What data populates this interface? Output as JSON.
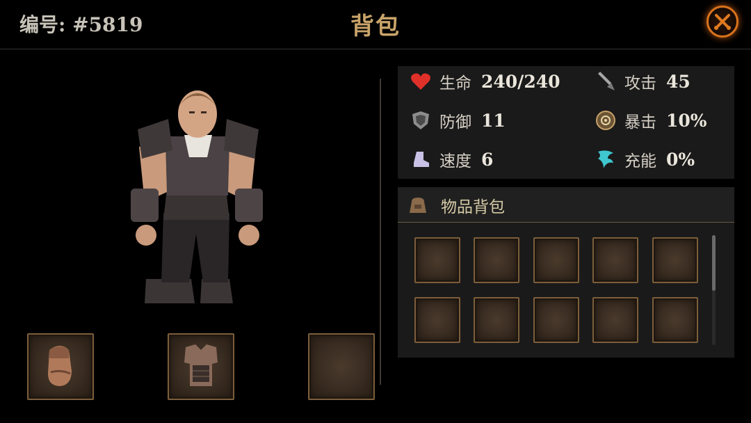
{
  "header": {
    "id_label": "编号: #5819",
    "title": "背包",
    "close_icon": "close-x-icon"
  },
  "character": {
    "portrait": "warrior-character-model"
  },
  "equipment_slots": [
    {
      "item": "gauntlet-icon"
    },
    {
      "item": "chest-armor-icon"
    },
    {
      "item": null
    }
  ],
  "stats": [
    {
      "icon": "heart-icon",
      "name": "生命",
      "value": "240/240",
      "color": "#e0302a"
    },
    {
      "icon": "sword-icon",
      "name": "攻击",
      "value": "45",
      "color": "#9a9a9a"
    },
    {
      "icon": "shield-icon",
      "name": "防御",
      "value": "11",
      "color": "#9a9a9a"
    },
    {
      "icon": "crit-icon",
      "name": "暴击",
      "value": "10%",
      "color": "#c8a26a"
    },
    {
      "icon": "boot-icon",
      "name": "速度",
      "value": "6",
      "color": "#c9c2e6"
    },
    {
      "icon": "energy-icon",
      "name": "充能",
      "value": "0%",
      "color": "#3fc7d0"
    }
  ],
  "bag": {
    "title": "物品背包",
    "icon": "bag-icon",
    "slots_count": 10
  },
  "colors": {
    "title_gold": "#c9a46a",
    "close_orange": "#d9721c",
    "slot_border": "#7c5e3b"
  }
}
